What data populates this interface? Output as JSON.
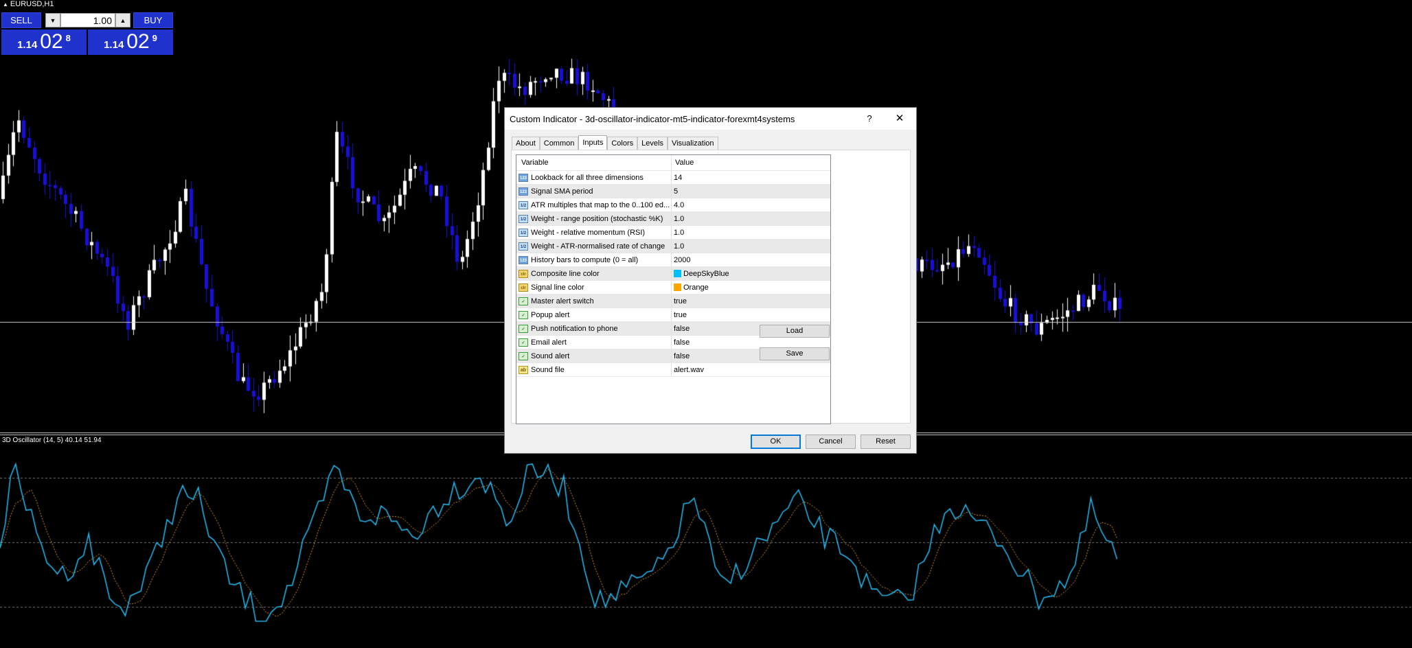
{
  "chart": {
    "symbol": "EURUSD,H1",
    "indicator_label": "3D Oscillator (14, 5) 40.14 51.94",
    "colors": {
      "bull_candle": "#ffffff",
      "bear_candle": "#1a0fd8",
      "composite_line": "#27b4e8",
      "signal_line": "#e89a3c",
      "level_line": "#7a7a7a"
    }
  },
  "trade_panel": {
    "sell_label": "SELL",
    "buy_label": "BUY",
    "lot": "1.00",
    "bid": {
      "prefix": "1.14",
      "big": "02",
      "sup": "8"
    },
    "ask": {
      "prefix": "1.14",
      "big": "02",
      "sup": "9"
    }
  },
  "dialog": {
    "title": "Custom Indicator - 3d-oscillator-indicator-mt5-indicator-forexmt4systems",
    "help": "?",
    "close": "✕",
    "tabs": [
      "About",
      "Common",
      "Inputs",
      "Colors",
      "Levels",
      "Visualization"
    ],
    "active_tab": "Inputs",
    "headers": {
      "variable": "Variable",
      "value": "Value"
    },
    "rows": [
      {
        "icon": "int",
        "variable": "Lookback for all three dimensions",
        "value": "14"
      },
      {
        "icon": "int",
        "variable": "Signal SMA period",
        "value": "5"
      },
      {
        "icon": "dbl",
        "variable": "ATR multiples that map to the 0..100 ed...",
        "value": "4.0"
      },
      {
        "icon": "dbl",
        "variable": "Weight - range position (stochastic %K)",
        "value": "1.0"
      },
      {
        "icon": "dbl",
        "variable": "Weight - relative momentum (RSI)",
        "value": "1.0"
      },
      {
        "icon": "dbl",
        "variable": "Weight - ATR-normalised rate of change",
        "value": "1.0"
      },
      {
        "icon": "int",
        "variable": "History bars to compute (0 = all)",
        "value": "2000"
      },
      {
        "icon": "clr",
        "variable": "Composite line color",
        "value": "DeepSkyBlue",
        "swatch": "#00bfff"
      },
      {
        "icon": "clr",
        "variable": "Signal line color",
        "value": "Orange",
        "swatch": "#ffa500"
      },
      {
        "icon": "bool",
        "variable": "Master alert switch",
        "value": "true"
      },
      {
        "icon": "bool",
        "variable": "Popup alert",
        "value": "true"
      },
      {
        "icon": "bool",
        "variable": "Push notification to phone",
        "value": "false"
      },
      {
        "icon": "bool",
        "variable": "Email alert",
        "value": "false"
      },
      {
        "icon": "bool",
        "variable": "Sound alert",
        "value": "false"
      },
      {
        "icon": "str",
        "variable": "Sound file",
        "value": "alert.wav"
      }
    ],
    "icon_text": {
      "int": "123",
      "dbl": "1/2",
      "clr": "clr",
      "bool": "✓",
      "str": "ab"
    },
    "load_label": "Load",
    "save_label": "Save",
    "ok_label": "OK",
    "cancel_label": "Cancel",
    "reset_label": "Reset"
  }
}
